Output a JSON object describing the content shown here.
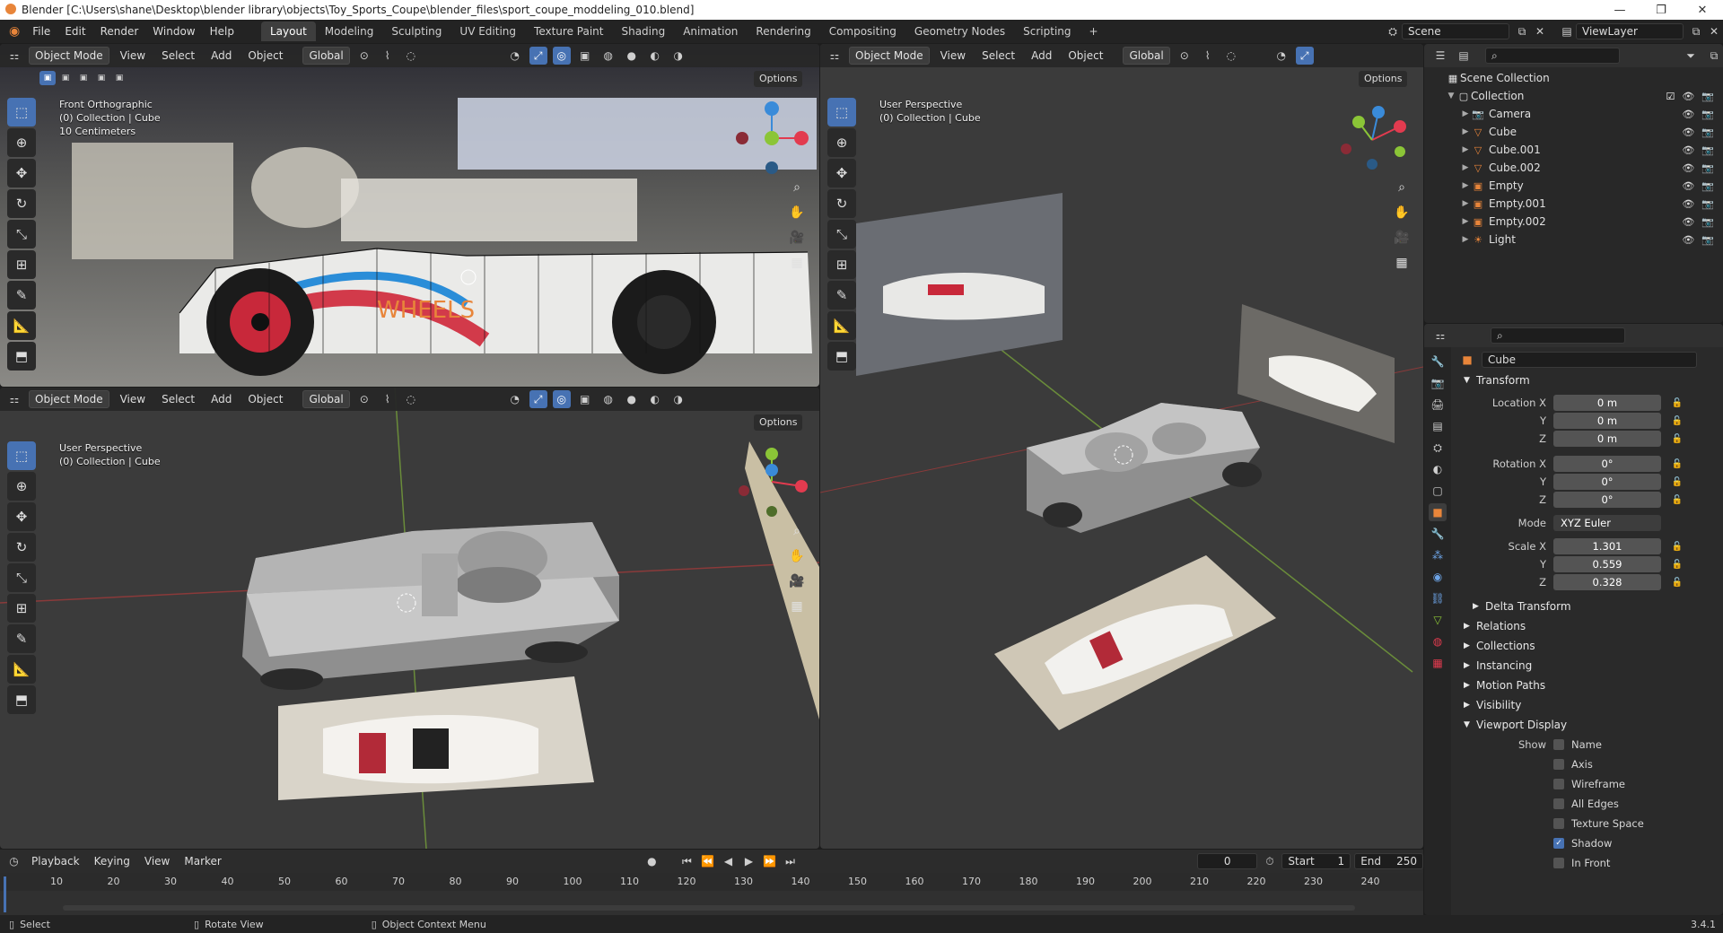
{
  "window": {
    "title": "Blender [C:\\Users\\shane\\Desktop\\blender library\\objects\\Toy_Sports_Coupe\\blender_files\\sport_coupe_moddeling_010.blend]"
  },
  "menu": [
    "File",
    "Edit",
    "Render",
    "Window",
    "Help"
  ],
  "workspaces": [
    "Layout",
    "Modeling",
    "Sculpting",
    "UV Editing",
    "Texture Paint",
    "Shading",
    "Animation",
    "Rendering",
    "Compositing",
    "Geometry Nodes",
    "Scripting"
  ],
  "active_workspace": "Layout",
  "scene": {
    "name": "Scene",
    "view_layer": "ViewLayer"
  },
  "viewport_header": {
    "mode": "Object Mode",
    "view": "View",
    "select": "Select",
    "add": "Add",
    "object": "Object",
    "orientation": "Global",
    "options": "Options"
  },
  "viewports": {
    "top_left": {
      "line1": "Front Orthographic",
      "line2": "(0) Collection | Cube",
      "line3": "10 Centimeters"
    },
    "bottom_left": {
      "line1": "User Perspective",
      "line2": "(0) Collection | Cube"
    },
    "right": {
      "line1": "User Perspective",
      "line2": "(0) Collection | Cube"
    }
  },
  "outliner": {
    "scene_collection": "Scene Collection",
    "collection": "Collection",
    "items": [
      {
        "name": "Camera",
        "icon": "camera-icon"
      },
      {
        "name": "Cube",
        "icon": "mesh-icon"
      },
      {
        "name": "Cube.001",
        "icon": "mesh-icon"
      },
      {
        "name": "Cube.002",
        "icon": "mesh-icon"
      },
      {
        "name": "Empty",
        "icon": "empty-image-icon"
      },
      {
        "name": "Empty.001",
        "icon": "empty-image-icon"
      },
      {
        "name": "Empty.002",
        "icon": "empty-image-icon"
      },
      {
        "name": "Light",
        "icon": "light-icon"
      }
    ]
  },
  "properties": {
    "object_name": "Cube",
    "transform_label": "Transform",
    "location": {
      "label": "Location X",
      "x": "0 m",
      "y": "0 m",
      "z": "0 m"
    },
    "rotation": {
      "label": "Rotation X",
      "x": "0°",
      "y": "0°",
      "z": "0°"
    },
    "mode": {
      "label": "Mode",
      "value": "XYZ Euler"
    },
    "scale": {
      "label": "Scale X",
      "x": "1.301",
      "y": "0.559",
      "z": "0.328"
    },
    "axis_labels": {
      "y": "Y",
      "z": "Z"
    },
    "panels": [
      "Delta Transform",
      "Relations",
      "Collections",
      "Instancing",
      "Motion Paths",
      "Visibility"
    ],
    "viewport_display": "Viewport Display",
    "show_label": "Show",
    "display_options": [
      {
        "label": "Name",
        "checked": false
      },
      {
        "label": "Axis",
        "checked": false
      },
      {
        "label": "Wireframe",
        "checked": false
      },
      {
        "label": "All Edges",
        "checked": false
      },
      {
        "label": "Texture Space",
        "checked": false
      },
      {
        "label": "Shadow",
        "checked": true
      },
      {
        "label": "In Front",
        "checked": false
      }
    ]
  },
  "timeline": {
    "playback": "Playback",
    "keying": "Keying",
    "view": "View",
    "marker": "Marker",
    "current_frame": "0",
    "start_label": "Start",
    "start": "1",
    "end_label": "End",
    "end": "250",
    "ticks": [
      "10",
      "20",
      "30",
      "40",
      "50",
      "60",
      "70",
      "80",
      "90",
      "100",
      "110",
      "120",
      "130",
      "140",
      "150",
      "160",
      "170",
      "180",
      "190",
      "200",
      "210",
      "220",
      "230",
      "240"
    ]
  },
  "statusbar": {
    "select": "Select",
    "rotate": "Rotate View",
    "context": "Object Context Menu",
    "version": "3.4.1"
  },
  "colors": {
    "accent": "#4772b3",
    "x_axis": "#e23b4f",
    "y_axis": "#8bc537",
    "z_axis": "#3a8bd9",
    "orange": "#e8853a"
  }
}
